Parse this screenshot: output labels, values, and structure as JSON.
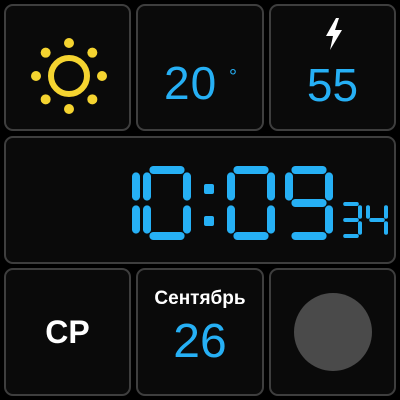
{
  "colors": {
    "accent": "#26b0f5",
    "sun": "#f5d430",
    "tile_border": "#3e3e3e",
    "text": "#ffffff",
    "circle": "#4a4a4a"
  },
  "weather": {
    "icon": "sun-icon"
  },
  "temperature": {
    "value": "20",
    "unit": "°"
  },
  "battery": {
    "icon": "lightning-bolt-icon",
    "value": "55"
  },
  "clock": {
    "hours": "10",
    "minutes": "09",
    "seconds": "34"
  },
  "day": {
    "label": "СР"
  },
  "date": {
    "month": "Сентябрь",
    "day": "26"
  },
  "circle": {
    "icon": "circle-icon"
  }
}
